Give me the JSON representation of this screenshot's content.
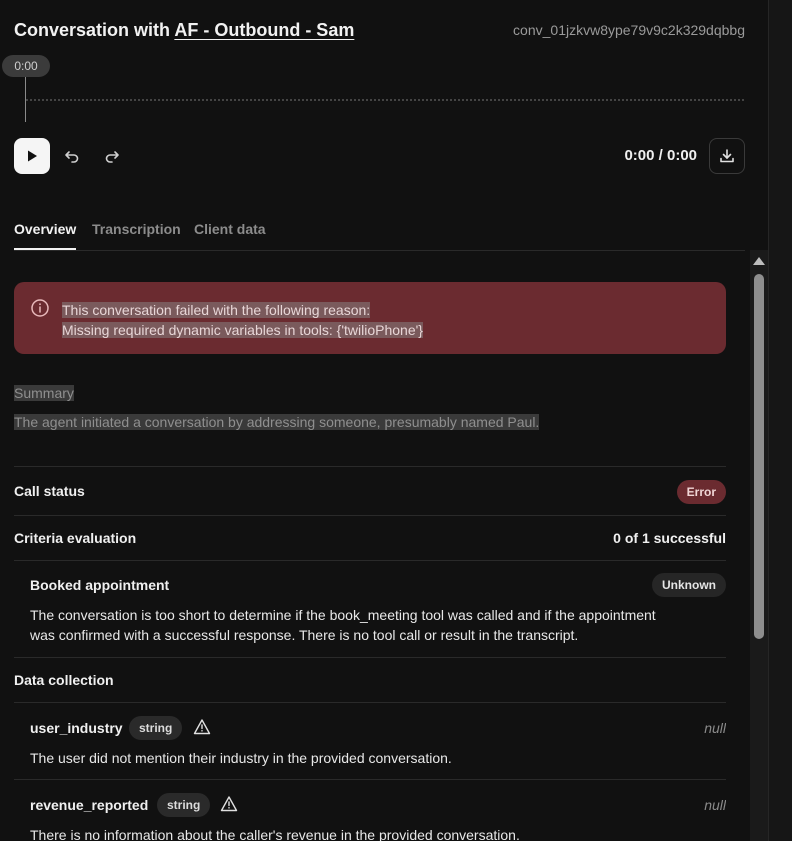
{
  "header": {
    "title_prefix": "Conversation with ",
    "agent_name": "AF - Outbound - Sam",
    "conversation_id": "conv_01jzkvw8ype79v9c2k329dqbbg"
  },
  "player": {
    "playhead_time": "0:00",
    "time_readout": "0:00 / 0:00",
    "progress": 0
  },
  "tabs": [
    {
      "label": "Overview",
      "active": true
    },
    {
      "label": "Transcription",
      "active": false
    },
    {
      "label": "Client data",
      "active": false
    }
  ],
  "error_banner": {
    "line1": "This conversation failed with the following reason:",
    "line2": "Missing required dynamic variables in tools: {'twilioPhone'}"
  },
  "summary": {
    "label": "Summary",
    "text": "The agent initiated a conversation by addressing someone, presumably named Paul."
  },
  "call_status": {
    "label": "Call status",
    "value": "Error"
  },
  "criteria": {
    "label": "Criteria evaluation",
    "result": "0 of 1 successful",
    "items": [
      {
        "title": "Booked appointment",
        "status": "Unknown",
        "description_line1": "The conversation is too short to determine if the book_meeting tool was called and if the appointment",
        "description_line2": "was confirmed with a successful response. There is no tool call or result in the transcript."
      }
    ]
  },
  "data_collection": {
    "label": "Data collection",
    "fields": [
      {
        "name": "user_industry",
        "type": "string",
        "value": "null",
        "description": "The user did not mention their industry in the provided conversation."
      },
      {
        "name": "revenue_reported",
        "type": "string",
        "value": "null",
        "description": "There is no information about the caller's revenue in the provided conversation."
      }
    ]
  },
  "colors": {
    "background": "#111111",
    "error_banner": "#6b2b30",
    "error_badge": "#6b2b30",
    "text_primary": "#f0f0f0",
    "text_muted": "#8c8c8c"
  }
}
